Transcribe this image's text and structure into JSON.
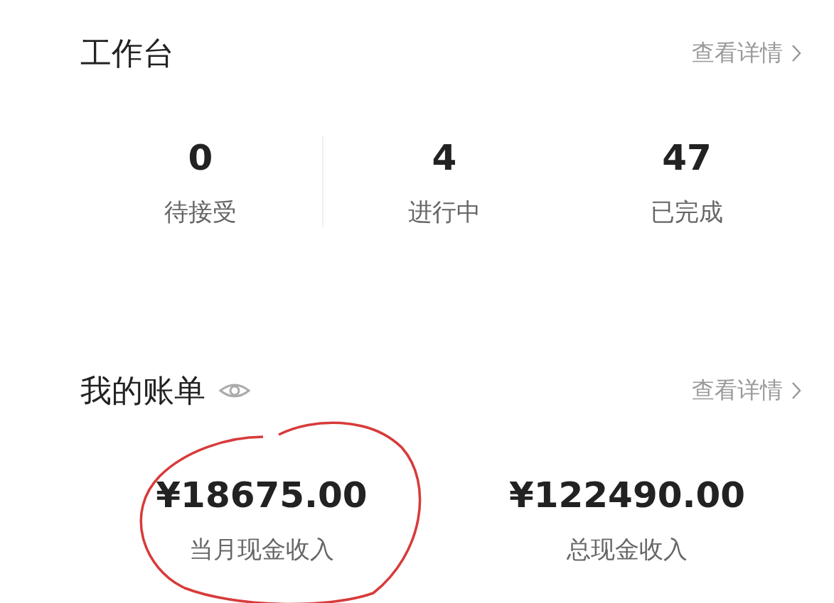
{
  "workbench": {
    "title": "工作台",
    "link": "查看详情",
    "stats": [
      {
        "value": "0",
        "label": "待接受"
      },
      {
        "value": "4",
        "label": "进行中"
      },
      {
        "value": "47",
        "label": "已完成"
      }
    ]
  },
  "bill": {
    "title": "我的账单",
    "link": "查看详情",
    "amounts": [
      {
        "value": "¥18675.00",
        "label": "当月现金收入"
      },
      {
        "value": "¥122490.00",
        "label": "总现金收入"
      }
    ]
  }
}
